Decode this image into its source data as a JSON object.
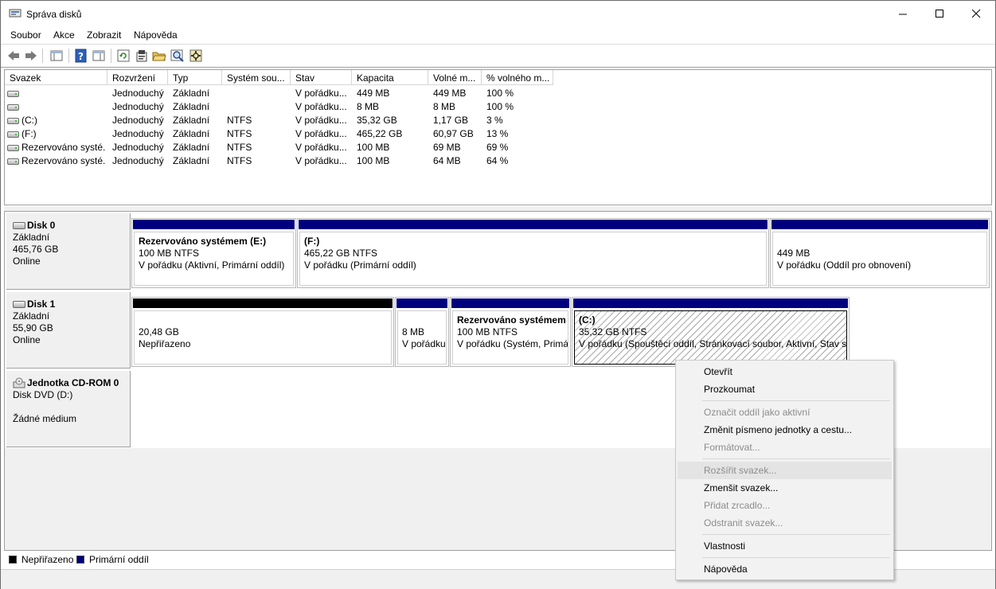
{
  "window": {
    "title": "Správa disků",
    "minimize_glyph": "—",
    "maximize_glyph": "☐",
    "close_glyph": "✕"
  },
  "menu": [
    "Soubor",
    "Akce",
    "Zobrazit",
    "Nápověda"
  ],
  "toolbar_icons": [
    "back-icon",
    "forward-icon",
    "console-tree-icon",
    "help-icon",
    "show-panel-icon",
    "refresh-icon",
    "properties-icon",
    "open-folder-icon",
    "explore-icon",
    "settings-icon"
  ],
  "columns": [
    "Svazek",
    "Rozvržení",
    "Typ",
    "Systém sou...",
    "Stav",
    "Kapacita",
    "Volné m...",
    "% volného m..."
  ],
  "volumes": [
    {
      "name": "",
      "layout": "Jednoduchý",
      "type": "Základní",
      "fs": "",
      "status": "V pořádku...",
      "capacity": "449 MB",
      "free": "449 MB",
      "pct": "100 %"
    },
    {
      "name": "",
      "layout": "Jednoduchý",
      "type": "Základní",
      "fs": "",
      "status": "V pořádku...",
      "capacity": "8 MB",
      "free": "8 MB",
      "pct": "100 %"
    },
    {
      "name": "(C:)",
      "layout": "Jednoduchý",
      "type": "Základní",
      "fs": "NTFS",
      "status": "V pořádku...",
      "capacity": "35,32 GB",
      "free": "1,17 GB",
      "pct": "3 %"
    },
    {
      "name": "(F:)",
      "layout": "Jednoduchý",
      "type": "Základní",
      "fs": "NTFS",
      "status": "V pořádku...",
      "capacity": "465,22 GB",
      "free": "60,97 GB",
      "pct": "13 %"
    },
    {
      "name": "Rezervováno systé...",
      "layout": "Jednoduchý",
      "type": "Základní",
      "fs": "NTFS",
      "status": "V pořádku...",
      "capacity": "100 MB",
      "free": "69 MB",
      "pct": "69 %"
    },
    {
      "name": "Rezervováno systé...",
      "layout": "Jednoduchý",
      "type": "Základní",
      "fs": "NTFS",
      "status": "V pořádku...",
      "capacity": "100 MB",
      "free": "64 MB",
      "pct": "64 %"
    }
  ],
  "disks": [
    {
      "name": "Disk 0",
      "kind": "Základní",
      "size": "465,76 GB",
      "state": "Online",
      "partitions": [
        {
          "title": "Rezervováno systémem  (E:)",
          "line1": "100 MB NTFS",
          "line2": "V pořádku (Aktivní, Primární oddíl)"
        },
        {
          "title": "(F:)",
          "line1": "465,22 GB NTFS",
          "line2": "V pořádku (Primární oddíl)"
        },
        {
          "title": "",
          "line1": "449 MB",
          "line2": "V pořádku (Oddíl pro obnovení)"
        }
      ]
    },
    {
      "name": "Disk 1",
      "kind": "Základní",
      "size": "55,90 GB",
      "state": "Online",
      "partitions": [
        {
          "title": "",
          "line1": "20,48 GB",
          "line2": "Nepřiřazeno"
        },
        {
          "title": "",
          "line1": "8 MB",
          "line2": "V pořádku"
        },
        {
          "title": "Rezervováno systémem",
          "line1": "100 MB NTFS",
          "line2": "V pořádku (Systém, Primá"
        },
        {
          "title": "(C:)",
          "line1": "35,32 GB NTFS",
          "line2": "V pořádku (Spouštěcí oddíl, Stránkovací soubor, Aktivní, Stav sy"
        }
      ]
    },
    {
      "name": "Jednotka CD-ROM 0",
      "kind": "Disk DVD (D:)",
      "size": "",
      "state": "Žádné médium"
    }
  ],
  "legend": {
    "unallocated": "Nepřiřazeno",
    "primary": "Primární oddíl"
  },
  "colors": {
    "primary": "#00007f",
    "unallocated": "#000000"
  },
  "context_menu": {
    "open": "Otevřít",
    "explore": "Prozkoumat",
    "mark_active": "Označit oddíl jako aktivní",
    "change_letter": "Změnit písmeno jednotky a cestu...",
    "format": "Formátovat...",
    "extend": "Rozšířit svazek...",
    "shrink": "Zmenšit svazek...",
    "add_mirror": "Přidat zrcadlo...",
    "delete": "Odstranit svazek...",
    "properties": "Vlastnosti",
    "help": "Nápověda"
  }
}
